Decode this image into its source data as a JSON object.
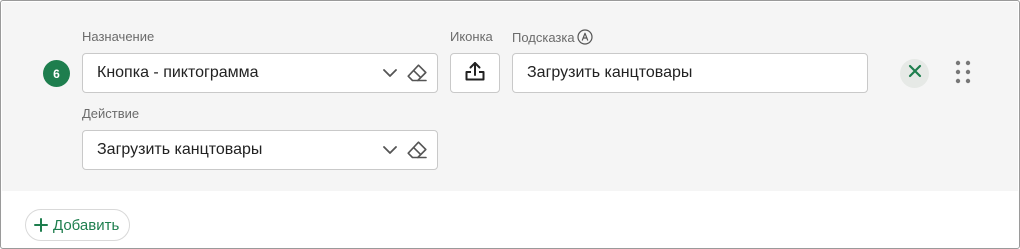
{
  "row": {
    "number": "6",
    "purpose": {
      "label": "Назначение",
      "value": "Кнопка - пиктограмма"
    },
    "icon": {
      "label": "Иконка",
      "glyph": "upload-icon"
    },
    "hint": {
      "label": "Подсказка",
      "info_icon": "info-icon",
      "value": "Загрузить канцтовары"
    },
    "action": {
      "label": "Действие",
      "value": "Загрузить канцтовары"
    }
  },
  "footer": {
    "add_label": "Добавить"
  },
  "colors": {
    "accent": "#1e7e4e",
    "row_background": "#f5f5f5",
    "border": "#c9c9c9"
  }
}
